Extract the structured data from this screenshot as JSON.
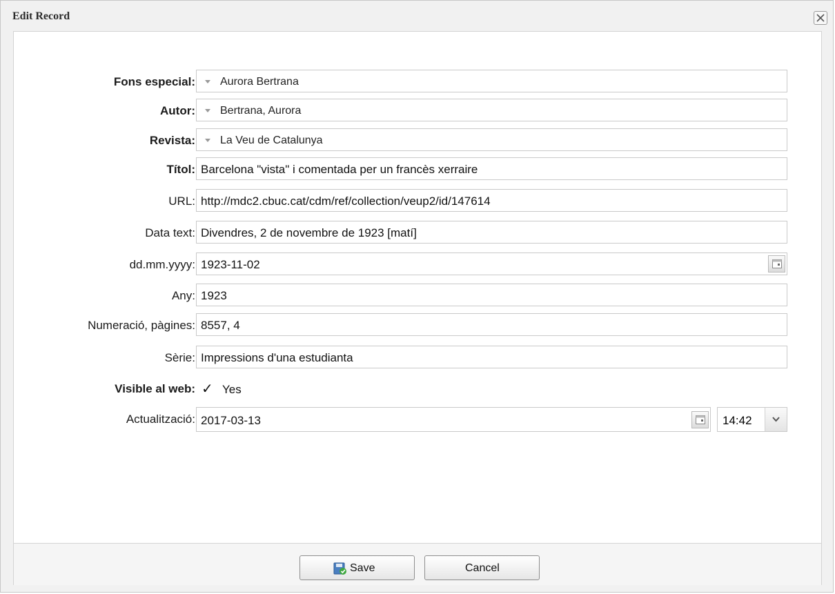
{
  "window": {
    "title": "Edit Record"
  },
  "form": {
    "fons": {
      "label": "Fons especial:",
      "value": "Aurora Bertrana"
    },
    "autor": {
      "label": "Autor:",
      "value": "Bertrana, Aurora"
    },
    "revista": {
      "label": "Revista:",
      "value": "La Veu de Catalunya"
    },
    "titol": {
      "label": "Títol:",
      "value": "Barcelona \"vista\" i comentada per un francès xerraire"
    },
    "url": {
      "label": "URL:",
      "value": "http://mdc2.cbuc.cat/cdm/ref/collection/veup2/id/147614"
    },
    "data_text": {
      "label": "Data text:",
      "value": "Divendres, 2 de novembre de 1923 [matí]"
    },
    "date": {
      "label": "dd.mm.yyyy:",
      "value": "1923-11-02"
    },
    "any": {
      "label": "Any:",
      "value": "1923"
    },
    "numeracio": {
      "label": "Numeració, pàgines:",
      "value": "8557, 4"
    },
    "serie": {
      "label": "Sèrie:",
      "value": "Impressions d'una estudianta"
    },
    "visible": {
      "label": "Visible al web:",
      "value": "Yes",
      "checked": true
    },
    "actualitzacio": {
      "label": "Actualització:",
      "date": "2017-03-13",
      "time": "14:42"
    }
  },
  "footer": {
    "save_label": "Save",
    "cancel_label": "Cancel"
  },
  "icons": {
    "close": "close-icon",
    "combo_caret": "caret-down-icon",
    "calendar": "calendar-icon",
    "checkmark": "check-icon",
    "dropdown": "chevron-down-icon",
    "save": "save-icon"
  }
}
